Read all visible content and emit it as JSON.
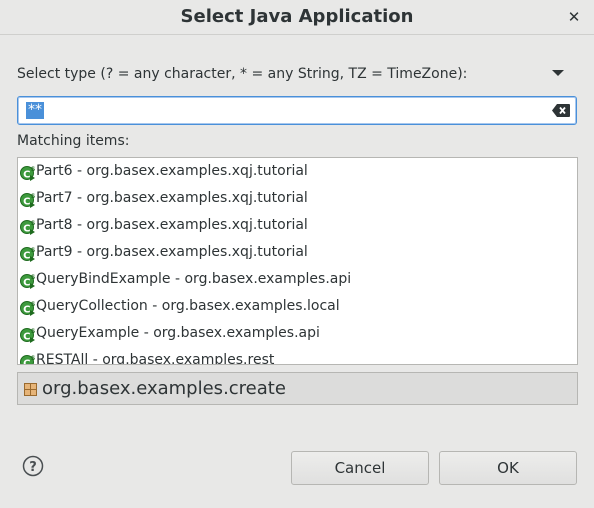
{
  "dialog": {
    "title": "Select Java Application",
    "close_icon": "close-icon"
  },
  "filter": {
    "label": "Select type (? = any character, * = any String, TZ = TimeZone):",
    "value": "**",
    "clear_icon": "clear-text-icon",
    "menu_icon": "view-menu-icon"
  },
  "matching": {
    "label": "Matching items:",
    "items": [
      {
        "icon": "java-class-main-icon",
        "label": "Part6 - org.basex.examples.xqj.tutorial"
      },
      {
        "icon": "java-class-main-icon",
        "label": "Part7 - org.basex.examples.xqj.tutorial"
      },
      {
        "icon": "java-class-main-icon",
        "label": "Part8 - org.basex.examples.xqj.tutorial"
      },
      {
        "icon": "java-class-main-icon",
        "label": "Part9 - org.basex.examples.xqj.tutorial"
      },
      {
        "icon": "java-class-main-icon",
        "label": "QueryBindExample - org.basex.examples.api"
      },
      {
        "icon": "java-class-main-icon",
        "label": "QueryCollection - org.basex.examples.local"
      },
      {
        "icon": "java-class-main-icon",
        "label": "QueryExample - org.basex.examples.api"
      },
      {
        "icon": "java-class-main-icon",
        "label": "RESTAll - org.basex.examples.rest"
      }
    ]
  },
  "details": {
    "icon": "package-icon",
    "text": "org.basex.examples.create"
  },
  "footer": {
    "help_icon": "help-icon",
    "cancel_label": "Cancel",
    "ok_label": "OK"
  },
  "colors": {
    "selection": "#4a90d9",
    "class_icon_green": "#3d9a3d"
  }
}
